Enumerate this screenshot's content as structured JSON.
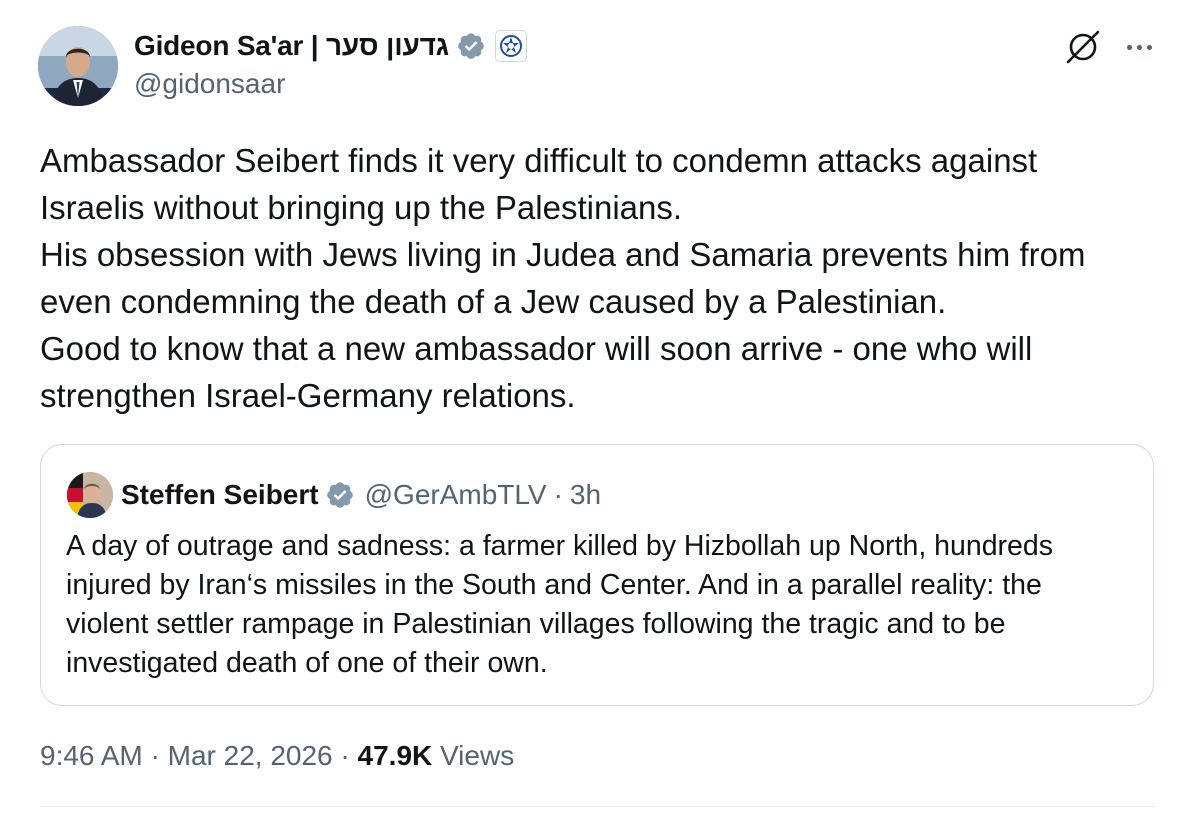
{
  "author": {
    "display_name": "Gideon Sa'ar | גדעון סער",
    "handle": "@gidonsaar",
    "avatar": "profile-photo",
    "verified_icon": "verified-badge-icon",
    "affiliate_icon": "government-affiliate-icon"
  },
  "actions": {
    "grok_icon": "grok-icon",
    "more_icon": "more-options-icon"
  },
  "tweet": {
    "lines": [
      "Ambassador Seibert finds it very difficult to condemn attacks against",
      "Israelis without bringing up the Palestinians.",
      "His obsession with Jews living in Judea and Samaria prevents him from",
      "even condemning the death of a Jew caused by a Palestinian.",
      "Good to know that a new ambassador will soon arrive - one who will",
      "strengthen Israel-Germany relations."
    ]
  },
  "quote": {
    "display_name": "Steffen Seibert",
    "handle": "@GerAmbTLV",
    "separator": "·",
    "time": "3h",
    "lines": [
      "A day of outrage and sadness: a farmer killed by Hizbollah up North, hundreds",
      "injured by Iran‘s missiles in the South and Center. And in a parallel reality: the",
      "violent settler rampage in Palestinian villages following the tragic and to be",
      "investigated death of one of their own."
    ]
  },
  "meta": {
    "time": "9:46 AM",
    "separator": "·",
    "date": "Mar 22, 2026",
    "views_count": "47.9K",
    "views_label": "Views"
  },
  "colors": {
    "text_primary": "#0f1419",
    "text_secondary": "#536471",
    "verified_blue": "#829aab",
    "border": "#cfd9de"
  }
}
